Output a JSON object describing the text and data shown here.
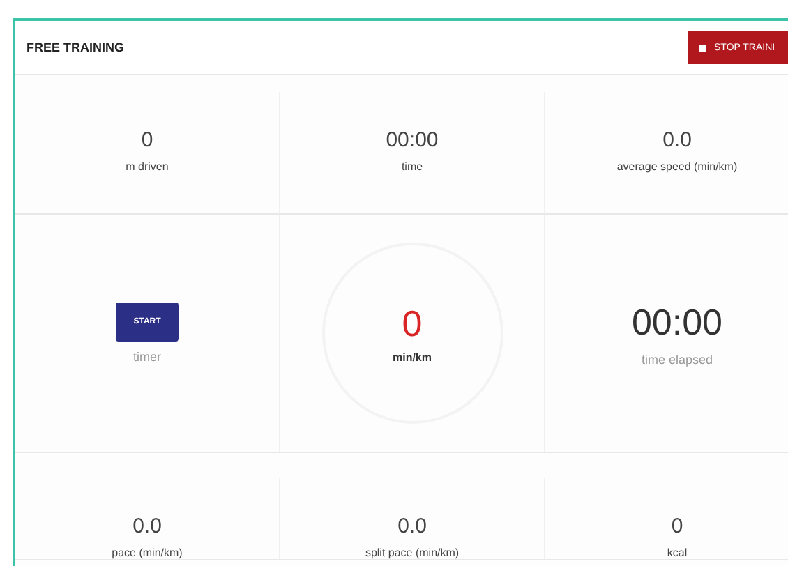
{
  "header": {
    "title": "FREE TRAINING",
    "stop_button": "STOP TRAINI"
  },
  "top_stats": [
    {
      "value": "0",
      "label": "m driven"
    },
    {
      "value": "00:00",
      "label": "time"
    },
    {
      "value": "0.0",
      "label": "average speed (min/km)"
    }
  ],
  "timer": {
    "button": "START",
    "label": "timer"
  },
  "pace": {
    "value": "0",
    "unit": "min/km"
  },
  "elapsed": {
    "value": "00:00",
    "label": "time elapsed"
  },
  "bottom_stats": [
    {
      "value": "0.0",
      "label": "pace (min/km)"
    },
    {
      "value": "0.0",
      "label": "split pace (min/km)"
    },
    {
      "value": "0",
      "label": "kcal"
    }
  ]
}
